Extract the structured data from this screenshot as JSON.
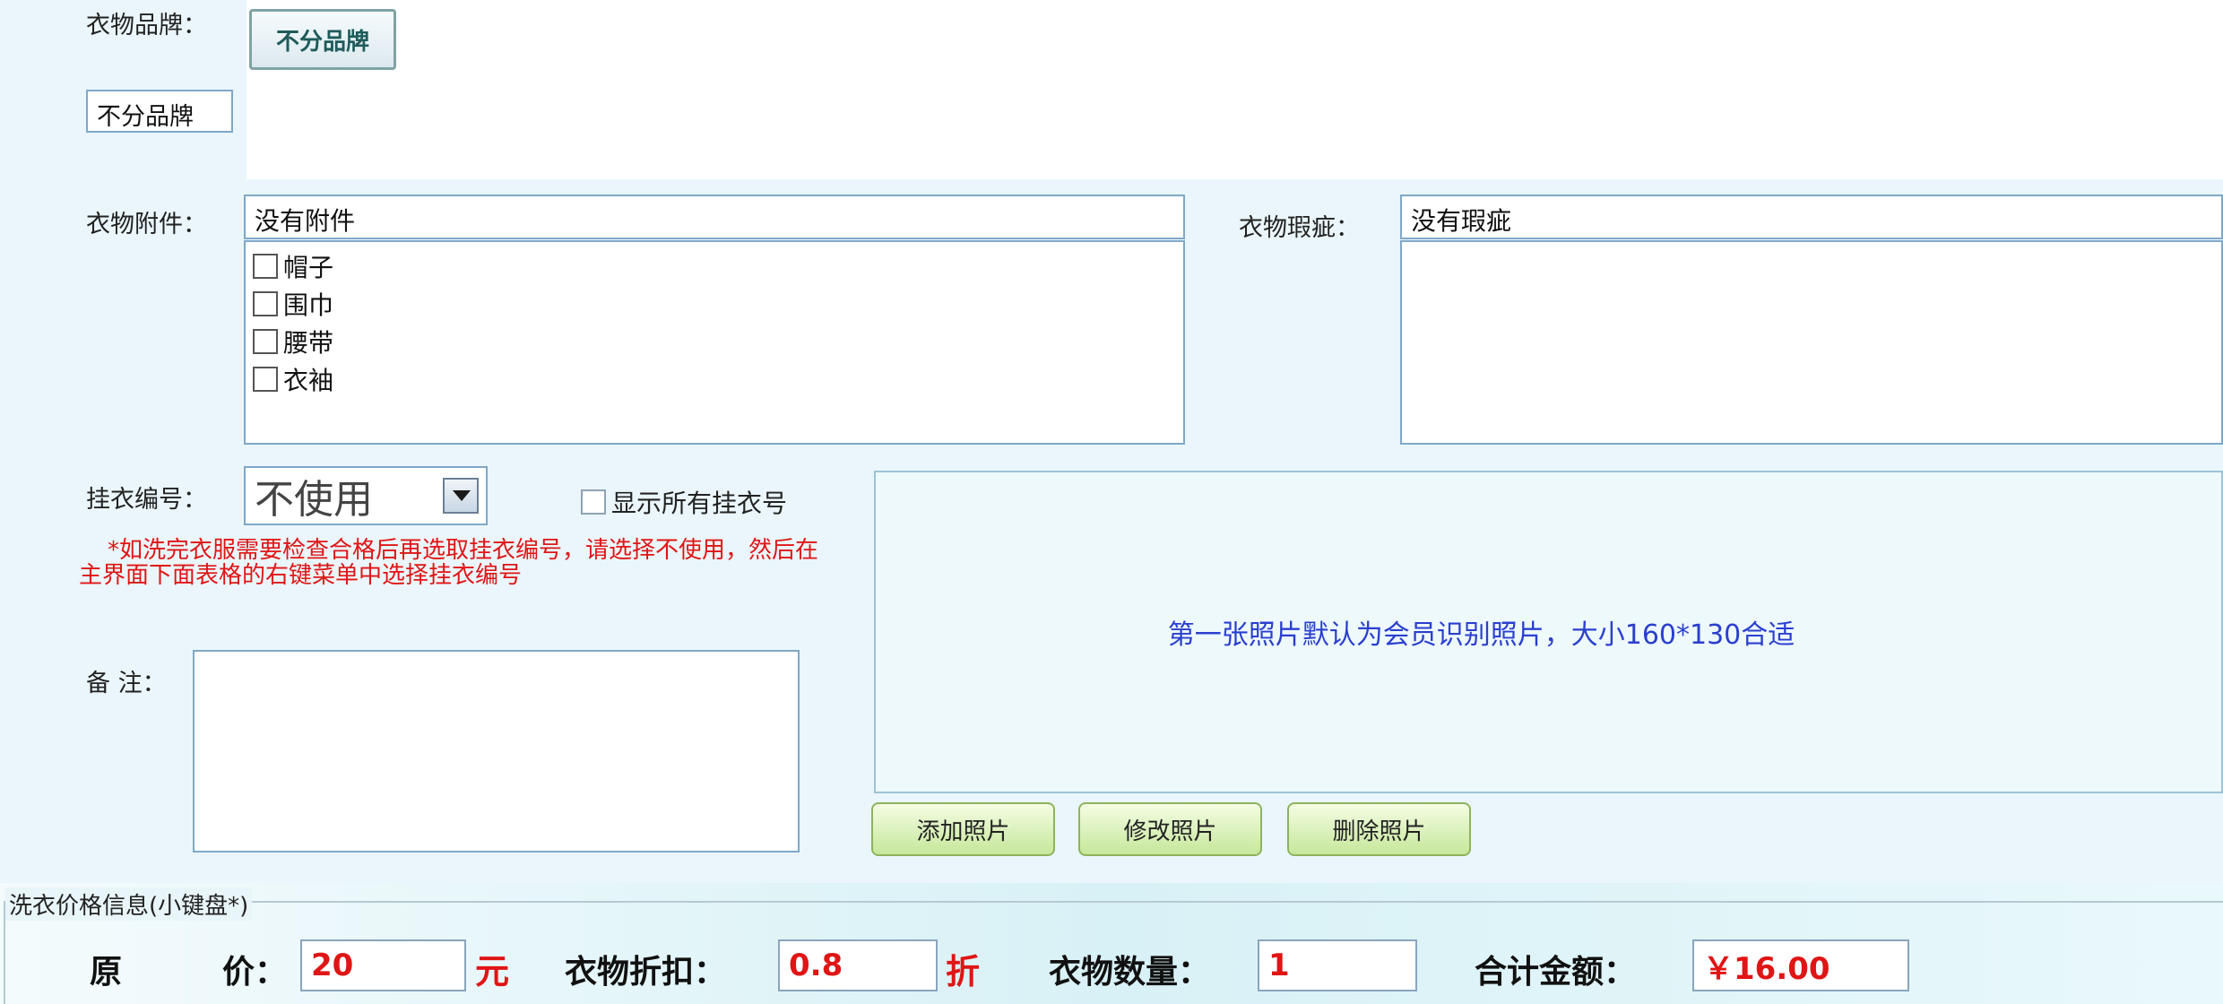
{
  "brand": {
    "label": "衣物品牌：",
    "button": "不分品牌",
    "selected": "不分品牌"
  },
  "accessories": {
    "label": "衣物附件：",
    "value": "没有附件",
    "items": [
      "帽子",
      "围巾",
      "腰带",
      "衣袖"
    ]
  },
  "defects": {
    "label": "衣物瑕疵：",
    "value": "没有瑕疵"
  },
  "hanger": {
    "label": "挂衣编号：",
    "selected": "不使用",
    "show_all_label": "显示所有挂衣号",
    "warning": "*如洗完衣服需要检查合格后再选取挂衣编号，请选择不使用，然后在主界面下面表格的右键菜单中选择挂衣编号"
  },
  "remark": {
    "label": "备 注：",
    "value": ""
  },
  "photo": {
    "tip": "第一张照片默认为会员识别照片，大小160*130合适",
    "add": "添加照片",
    "edit": "修改照片",
    "delete": "删除照片"
  },
  "price": {
    "legend": "洗衣价格信息(小键盘*)",
    "orig_label_1": "原",
    "orig_label_2": "价：",
    "orig_value": "20",
    "orig_unit": "元",
    "discount_label": "衣物折扣：",
    "discount_value": "0.8",
    "discount_unit": "折",
    "qty_label": "衣物数量：",
    "qty_value": "1",
    "total_label": "合计金额：",
    "total_value": "￥16.00"
  },
  "colors": {
    "warning_red": "#e01515",
    "tip_blue": "#2a3fcf",
    "button_green": "#c6e79a",
    "border_blue": "#7fa8c8"
  }
}
